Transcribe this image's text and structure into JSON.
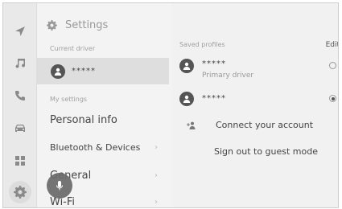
{
  "nav_rail": {
    "items": [
      {
        "icon": "navigation-icon"
      },
      {
        "icon": "music-icon"
      },
      {
        "icon": "phone-icon"
      },
      {
        "icon": "car-icon"
      },
      {
        "icon": "apps-grid-icon"
      },
      {
        "icon": "settings-gear-icon",
        "active": true
      }
    ]
  },
  "settings": {
    "title": "Settings",
    "current_driver_label": "Current driver",
    "current_driver_name": "*****",
    "my_settings_label": "My settings",
    "menu": [
      {
        "label": "Personal info"
      },
      {
        "label": "Bluetooth & Devices"
      },
      {
        "label": "General"
      },
      {
        "label": "Wi-Fi"
      }
    ]
  },
  "profiles": {
    "saved_label": "Saved profiles",
    "edit_label": "Edit",
    "items": [
      {
        "name": "*****",
        "subtitle": "Primary driver",
        "selected": false
      },
      {
        "name": "*****",
        "subtitle": "",
        "selected": true
      }
    ],
    "connect_label": "Connect your account",
    "signout_label": "Sign out to guest mode"
  },
  "colors": {
    "background": "#f1f1f1",
    "highlight": "#dedede",
    "avatar": "#555555",
    "mic": "#6a6a6a"
  }
}
